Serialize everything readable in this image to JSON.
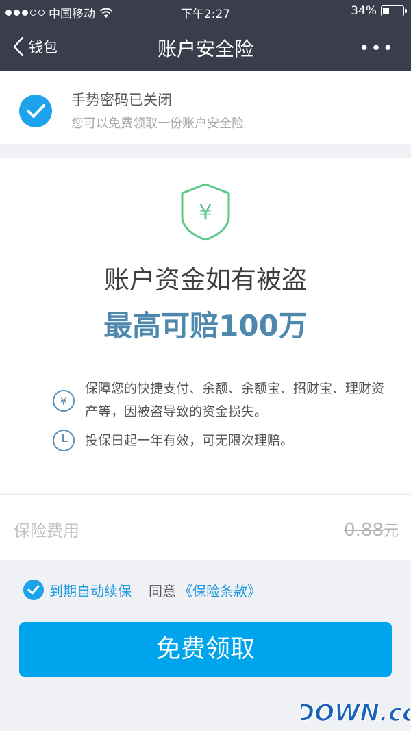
{
  "status_bar": {
    "carrier": "中国移动",
    "time": "下午2:27",
    "battery": "34%"
  },
  "nav": {
    "back_label": "钱包",
    "title": "账户安全险",
    "more_label": "•••"
  },
  "notice": {
    "title": "手势密码已关闭",
    "subtitle": "您可以免费领取一份账户安全险"
  },
  "hero": {
    "shield_symbol": "¥",
    "headline": "账户资金如有被盗",
    "highlight": "最高可赔100万",
    "features": [
      {
        "icon": "yen-circle-icon",
        "icon_text": "¥",
        "text": "保障您的快捷支付、余额、余额宝、招财宝、理财资产等，因被盗导致的资金损失。"
      },
      {
        "icon": "clock-icon",
        "text": "投保日起一年有效，可无限次理赔。"
      }
    ]
  },
  "fee": {
    "label": "保险费用",
    "price": "0.88",
    "unit": "元"
  },
  "agreement": {
    "auto_renew": "到期自动续保",
    "agree": "同意",
    "terms": "《保险条款》"
  },
  "cta": {
    "label": "免费领取"
  },
  "watermark": {
    "text": "DOWN.cc"
  },
  "colors": {
    "nav_bg": "#3a3d4b",
    "accent": "#1ca3ec",
    "highlight": "#4f88ad",
    "shield": "#5cc98a"
  }
}
